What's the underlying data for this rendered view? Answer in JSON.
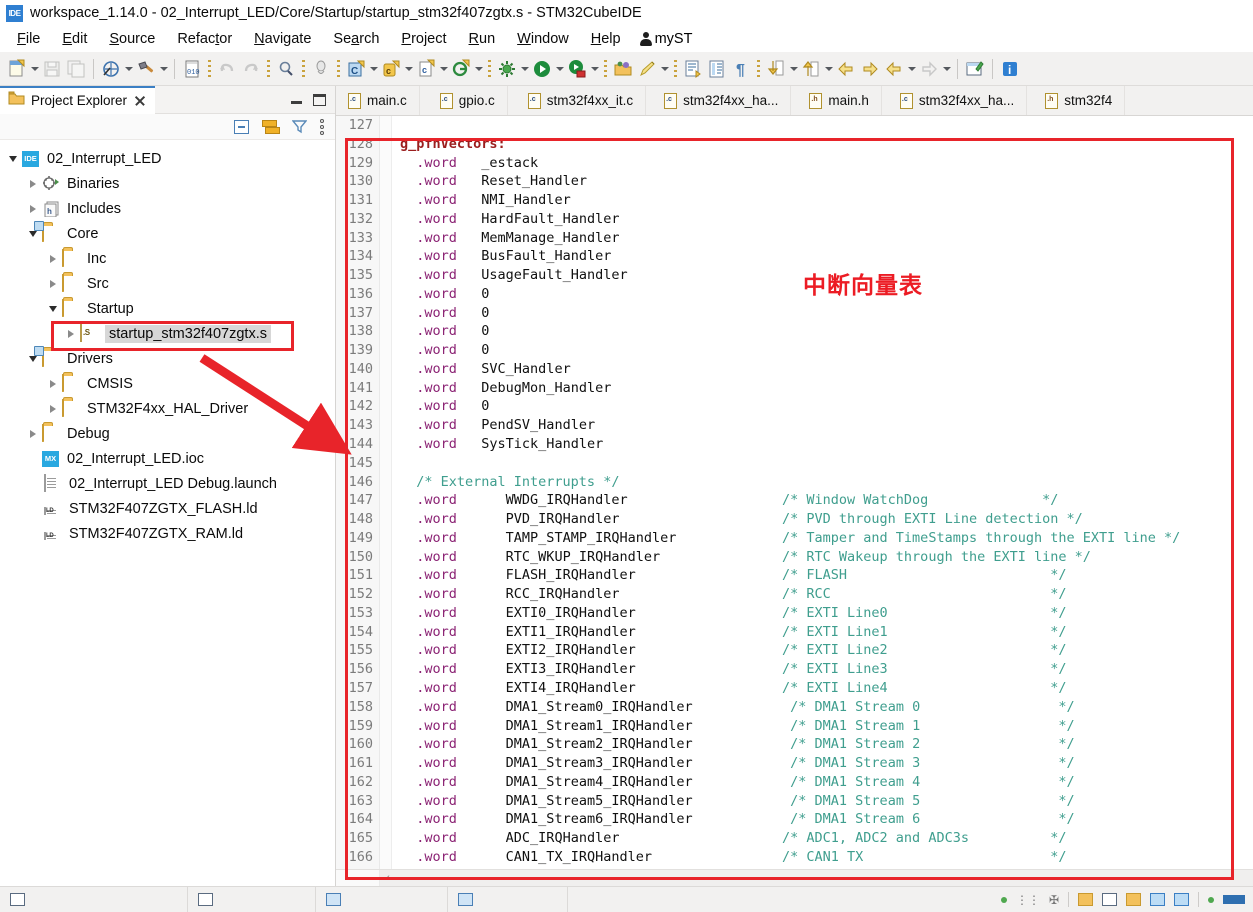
{
  "window": {
    "app_icon": "ide-icon",
    "title": "workspace_1.14.0 - 02_Interrupt_LED/Core/Startup/startup_stm32f407zgtx.s - STM32CubeIDE"
  },
  "menubar": {
    "items": [
      "File",
      "Edit",
      "Source",
      "Refactor",
      "Navigate",
      "Search",
      "Project",
      "Run",
      "Window",
      "Help"
    ],
    "account_label": "myST",
    "account_icon": "person-icon"
  },
  "toolbar": {
    "icons": [
      "new-file-icon",
      "save-icon",
      "save-all-icon",
      "build-all-icon",
      "build-hammer-icon",
      "binary-010-icon",
      "undo-icon",
      "redo-icon",
      "search-icon",
      "open-type-icon",
      "new-c-project-icon",
      "new-c-class-icon",
      "new-c-file-icon",
      "new-git-icon",
      "debug-configure-icon",
      "run-icon",
      "debug-run-icon",
      "open-resource-icon",
      "edit-pen-icon",
      "next-annotation-icon",
      "toggle-block-icon",
      "pilcrow-icon",
      "next-edit-icon",
      "prev-edit-icon",
      "back-nav-icon",
      "forward-nav-icon",
      "back-history-icon",
      "forward-history-icon",
      "new-window-icon",
      "info-icon"
    ]
  },
  "project_explorer": {
    "view_title": "Project Explorer",
    "view_icon": "project-explorer-icon",
    "close_icon": "close-icon",
    "minimize_icon": "minimize-icon",
    "maximize_icon": "maximize-icon",
    "toolbar_icons": [
      "collapse-all-icon",
      "link-with-editor-icon",
      "filter-icon",
      "view-menu-icon"
    ],
    "tree": [
      {
        "label": "02_Interrupt_LED",
        "indent": 0,
        "arrow": "down",
        "icon": "ide-project-icon",
        "selected": false
      },
      {
        "label": "Binaries",
        "indent": 1,
        "arrow": "right",
        "icon": "binaries-icon",
        "selected": false
      },
      {
        "label": "Includes",
        "indent": 1,
        "arrow": "right",
        "icon": "includes-icon",
        "selected": false
      },
      {
        "label": "Core",
        "indent": 1,
        "arrow": "down",
        "icon": "source-folder-icon",
        "selected": false
      },
      {
        "label": "Inc",
        "indent": 2,
        "arrow": "right",
        "icon": "folder-icon",
        "selected": false
      },
      {
        "label": "Src",
        "indent": 2,
        "arrow": "right",
        "icon": "folder-icon",
        "selected": false
      },
      {
        "label": "Startup",
        "indent": 2,
        "arrow": "down",
        "icon": "folder-icon",
        "selected": false
      },
      {
        "label": "startup_stm32f407zgtx.s",
        "indent": 3,
        "arrow": "right",
        "icon": "asm-file-icon",
        "selected": true
      },
      {
        "label": "Drivers",
        "indent": 1,
        "arrow": "down",
        "icon": "source-folder-icon",
        "selected": false
      },
      {
        "label": "CMSIS",
        "indent": 2,
        "arrow": "right",
        "icon": "folder-icon",
        "selected": false
      },
      {
        "label": "STM32F4xx_HAL_Driver",
        "indent": 2,
        "arrow": "right",
        "icon": "folder-icon",
        "selected": false
      },
      {
        "label": "Debug",
        "indent": 1,
        "arrow": "right",
        "icon": "folder-icon",
        "selected": false
      },
      {
        "label": "02_Interrupt_LED.ioc",
        "indent": 1,
        "arrow": "none",
        "icon": "ioc-icon",
        "selected": false
      },
      {
        "label": "02_Interrupt_LED Debug.launch",
        "indent": 1,
        "arrow": "none",
        "icon": "launch-icon",
        "selected": false
      },
      {
        "label": "STM32F407ZGTX_FLASH.ld",
        "indent": 1,
        "arrow": "none",
        "icon": "ld-file-icon",
        "selected": false
      },
      {
        "label": "STM32F407ZGTX_RAM.ld",
        "indent": 1,
        "arrow": "none",
        "icon": "ld-file-icon",
        "selected": false
      }
    ]
  },
  "editor": {
    "tabs": [
      {
        "label": "main.c",
        "kind": "c",
        "active": false
      },
      {
        "label": "gpio.c",
        "kind": "c",
        "active": false
      },
      {
        "label": "stm32f4xx_it.c",
        "kind": "c",
        "active": false
      },
      {
        "label": "stm32f4xx_ha...",
        "kind": "c",
        "active": false
      },
      {
        "label": "main.h",
        "kind": "h",
        "active": false
      },
      {
        "label": "stm32f4xx_ha...",
        "kind": "c",
        "active": false
      },
      {
        "label": "stm32f4",
        "kind": "h",
        "active": false
      }
    ],
    "first_line_number": 127,
    "lines": [
      {
        "n": 127,
        "segments": []
      },
      {
        "n": 128,
        "segments": [
          {
            "t": "g_pfnVectors:",
            "c": "k-lbl"
          }
        ]
      },
      {
        "n": 129,
        "segments": [
          {
            "t": "  .word",
            "c": "k-dir"
          },
          {
            "t": "   _estack",
            "c": "k-id"
          }
        ]
      },
      {
        "n": 130,
        "segments": [
          {
            "t": "  .word",
            "c": "k-dir"
          },
          {
            "t": "   Reset_Handler",
            "c": "k-id"
          }
        ]
      },
      {
        "n": 131,
        "segments": [
          {
            "t": "  .word",
            "c": "k-dir"
          },
          {
            "t": "   NMI_Handler",
            "c": "k-id"
          }
        ]
      },
      {
        "n": 132,
        "segments": [
          {
            "t": "  .word",
            "c": "k-dir"
          },
          {
            "t": "   HardFault_Handler",
            "c": "k-id"
          }
        ]
      },
      {
        "n": 133,
        "segments": [
          {
            "t": "  .word",
            "c": "k-dir"
          },
          {
            "t": "   MemManage_Handler",
            "c": "k-id"
          }
        ]
      },
      {
        "n": 134,
        "segments": [
          {
            "t": "  .word",
            "c": "k-dir"
          },
          {
            "t": "   BusFault_Handler",
            "c": "k-id"
          }
        ]
      },
      {
        "n": 135,
        "segments": [
          {
            "t": "  .word",
            "c": "k-dir"
          },
          {
            "t": "   UsageFault_Handler",
            "c": "k-id"
          }
        ]
      },
      {
        "n": 136,
        "segments": [
          {
            "t": "  .word",
            "c": "k-dir"
          },
          {
            "t": "   0",
            "c": "k-id"
          }
        ]
      },
      {
        "n": 137,
        "segments": [
          {
            "t": "  .word",
            "c": "k-dir"
          },
          {
            "t": "   0",
            "c": "k-id"
          }
        ]
      },
      {
        "n": 138,
        "segments": [
          {
            "t": "  .word",
            "c": "k-dir"
          },
          {
            "t": "   0",
            "c": "k-id"
          }
        ]
      },
      {
        "n": 139,
        "segments": [
          {
            "t": "  .word",
            "c": "k-dir"
          },
          {
            "t": "   0",
            "c": "k-id"
          }
        ]
      },
      {
        "n": 140,
        "segments": [
          {
            "t": "  .word",
            "c": "k-dir"
          },
          {
            "t": "   SVC_Handler",
            "c": "k-id"
          }
        ]
      },
      {
        "n": 141,
        "segments": [
          {
            "t": "  .word",
            "c": "k-dir"
          },
          {
            "t": "   DebugMon_Handler",
            "c": "k-id"
          }
        ]
      },
      {
        "n": 142,
        "segments": [
          {
            "t": "  .word",
            "c": "k-dir"
          },
          {
            "t": "   0",
            "c": "k-id"
          }
        ]
      },
      {
        "n": 143,
        "segments": [
          {
            "t": "  .word",
            "c": "k-dir"
          },
          {
            "t": "   PendSV_Handler",
            "c": "k-id"
          }
        ]
      },
      {
        "n": 144,
        "segments": [
          {
            "t": "  .word",
            "c": "k-dir"
          },
          {
            "t": "   SysTick_Handler",
            "c": "k-id"
          }
        ]
      },
      {
        "n": 145,
        "segments": []
      },
      {
        "n": 146,
        "segments": [
          {
            "t": "  /* External Interrupts */",
            "c": "k-cmt"
          }
        ]
      },
      {
        "n": 147,
        "segments": [
          {
            "t": "  .word",
            "c": "k-dir"
          },
          {
            "t": "      WWDG_IRQHandler                   ",
            "c": "k-id"
          },
          {
            "t": "/* Window WatchDog              */",
            "c": "k-cmt"
          }
        ]
      },
      {
        "n": 148,
        "segments": [
          {
            "t": "  .word",
            "c": "k-dir"
          },
          {
            "t": "      PVD_IRQHandler                    ",
            "c": "k-id"
          },
          {
            "t": "/* PVD through EXTI Line detection */",
            "c": "k-cmt"
          }
        ]
      },
      {
        "n": 149,
        "segments": [
          {
            "t": "  .word",
            "c": "k-dir"
          },
          {
            "t": "      TAMP_STAMP_IRQHandler             ",
            "c": "k-id"
          },
          {
            "t": "/* Tamper and TimeStamps through the EXTI line */",
            "c": "k-cmt"
          }
        ]
      },
      {
        "n": 150,
        "segments": [
          {
            "t": "  .word",
            "c": "k-dir"
          },
          {
            "t": "      RTC_WKUP_IRQHandler               ",
            "c": "k-id"
          },
          {
            "t": "/* RTC Wakeup through the EXTI line */",
            "c": "k-cmt"
          }
        ]
      },
      {
        "n": 151,
        "segments": [
          {
            "t": "  .word",
            "c": "k-dir"
          },
          {
            "t": "      FLASH_IRQHandler                  ",
            "c": "k-id"
          },
          {
            "t": "/* FLASH                         */",
            "c": "k-cmt"
          }
        ]
      },
      {
        "n": 152,
        "segments": [
          {
            "t": "  .word",
            "c": "k-dir"
          },
          {
            "t": "      RCC_IRQHandler                    ",
            "c": "k-id"
          },
          {
            "t": "/* RCC                           */",
            "c": "k-cmt"
          }
        ]
      },
      {
        "n": 153,
        "segments": [
          {
            "t": "  .word",
            "c": "k-dir"
          },
          {
            "t": "      EXTI0_IRQHandler                  ",
            "c": "k-id"
          },
          {
            "t": "/* EXTI Line0                    */",
            "c": "k-cmt"
          }
        ]
      },
      {
        "n": 154,
        "segments": [
          {
            "t": "  .word",
            "c": "k-dir"
          },
          {
            "t": "      EXTI1_IRQHandler                  ",
            "c": "k-id"
          },
          {
            "t": "/* EXTI Line1                    */",
            "c": "k-cmt"
          }
        ]
      },
      {
        "n": 155,
        "segments": [
          {
            "t": "  .word",
            "c": "k-dir"
          },
          {
            "t": "      EXTI2_IRQHandler                  ",
            "c": "k-id"
          },
          {
            "t": "/* EXTI Line2                    */",
            "c": "k-cmt"
          }
        ]
      },
      {
        "n": 156,
        "segments": [
          {
            "t": "  .word",
            "c": "k-dir"
          },
          {
            "t": "      EXTI3_IRQHandler                  ",
            "c": "k-id"
          },
          {
            "t": "/* EXTI Line3                    */",
            "c": "k-cmt"
          }
        ]
      },
      {
        "n": 157,
        "segments": [
          {
            "t": "  .word",
            "c": "k-dir"
          },
          {
            "t": "      EXTI4_IRQHandler                  ",
            "c": "k-id"
          },
          {
            "t": "/* EXTI Line4                    */",
            "c": "k-cmt"
          }
        ]
      },
      {
        "n": 158,
        "segments": [
          {
            "t": "  .word",
            "c": "k-dir"
          },
          {
            "t": "      DMA1_Stream0_IRQHandler            ",
            "c": "k-id"
          },
          {
            "t": "/* DMA1 Stream 0                 */",
            "c": "k-cmt"
          }
        ]
      },
      {
        "n": 159,
        "segments": [
          {
            "t": "  .word",
            "c": "k-dir"
          },
          {
            "t": "      DMA1_Stream1_IRQHandler            ",
            "c": "k-id"
          },
          {
            "t": "/* DMA1 Stream 1                 */",
            "c": "k-cmt"
          }
        ]
      },
      {
        "n": 160,
        "segments": [
          {
            "t": "  .word",
            "c": "k-dir"
          },
          {
            "t": "      DMA1_Stream2_IRQHandler            ",
            "c": "k-id"
          },
          {
            "t": "/* DMA1 Stream 2                 */",
            "c": "k-cmt"
          }
        ]
      },
      {
        "n": 161,
        "segments": [
          {
            "t": "  .word",
            "c": "k-dir"
          },
          {
            "t": "      DMA1_Stream3_IRQHandler            ",
            "c": "k-id"
          },
          {
            "t": "/* DMA1 Stream 3                 */",
            "c": "k-cmt"
          }
        ]
      },
      {
        "n": 162,
        "segments": [
          {
            "t": "  .word",
            "c": "k-dir"
          },
          {
            "t": "      DMA1_Stream4_IRQHandler            ",
            "c": "k-id"
          },
          {
            "t": "/* DMA1 Stream 4                 */",
            "c": "k-cmt"
          }
        ]
      },
      {
        "n": 163,
        "segments": [
          {
            "t": "  .word",
            "c": "k-dir"
          },
          {
            "t": "      DMA1_Stream5_IRQHandler            ",
            "c": "k-id"
          },
          {
            "t": "/* DMA1 Stream 5                 */",
            "c": "k-cmt"
          }
        ]
      },
      {
        "n": 164,
        "segments": [
          {
            "t": "  .word",
            "c": "k-dir"
          },
          {
            "t": "      DMA1_Stream6_IRQHandler            ",
            "c": "k-id"
          },
          {
            "t": "/* DMA1 Stream 6                 */",
            "c": "k-cmt"
          }
        ]
      },
      {
        "n": 165,
        "segments": [
          {
            "t": "  .word",
            "c": "k-dir"
          },
          {
            "t": "      ADC_IRQHandler                    ",
            "c": "k-id"
          },
          {
            "t": "/* ADC1, ADC2 and ADC3s          */",
            "c": "k-cmt"
          }
        ]
      },
      {
        "n": 166,
        "segments": [
          {
            "t": "  .word",
            "c": "k-dir"
          },
          {
            "t": "      CAN1_TX_IRQHandler                ",
            "c": "k-id"
          },
          {
            "t": "/* CAN1 TX                       */",
            "c": "k-cmt"
          }
        ]
      }
    ]
  },
  "annotations": {
    "chinese_label": "中断向量表",
    "accent_color": "#ec1c24",
    "arrow_icon": "red-arrow-icon",
    "highlight_box_icon": "red-highlight-box"
  },
  "colors": {
    "directive": "#8b2374",
    "label": "#9b1f1f",
    "comment": "#3f9e8e",
    "identifier": "#111111",
    "annotation_red": "#ec1c24",
    "tab_accent": "#3b7fc4"
  }
}
